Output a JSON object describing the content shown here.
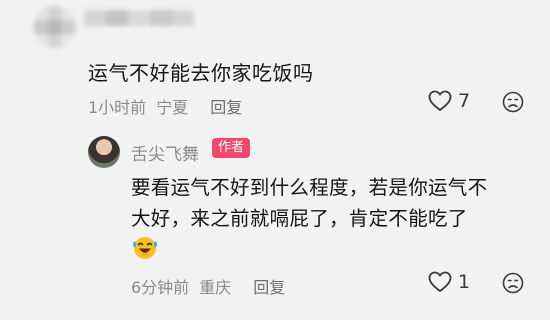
{
  "top_comment": {
    "text": "运气不好能去你家吃饭吗",
    "time": "1小时前",
    "location": "宁夏",
    "reply_label": "回复",
    "like_count": "7"
  },
  "reply": {
    "username": "舌尖飞舞",
    "badge": "作者",
    "text_lines": [
      "要看运气不好到什么程度，若是你运气不",
      "大好，来之前就嗝屁了，肯定不能吃了"
    ],
    "emoji_icon": "laughing-crying-emoji-icon",
    "time": "6分钟前",
    "location": "重庆",
    "reply_label": "回复",
    "like_count": "1"
  },
  "colors": {
    "background": "#f2f2f2",
    "badge": "#f2476a",
    "meta_text": "#8a8a8a"
  }
}
